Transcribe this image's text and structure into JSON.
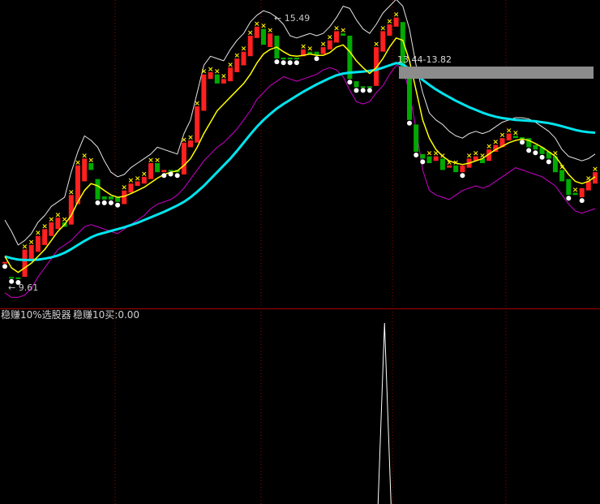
{
  "annotations": {
    "high_label": "15.49",
    "low_label": "9.61",
    "range_label": "13.44-13.82"
  },
  "indicator": {
    "name": "稳赚10%选股器",
    "value_label": "稳赚10买:0.00"
  },
  "colors": {
    "background": "#000000",
    "up_candle": "#ff2020",
    "down_candle": "#00aa00",
    "fast_ma": "#ffff00",
    "slow_ma": "#00e5ee",
    "upper_band": "#e6e6e6",
    "lower_band": "#cc00cc",
    "marker_x": "#ffee00",
    "marker_dot": "#ffffff",
    "pane_divider": "#aa0000",
    "v_grid": "#a00000",
    "range_box": "#8c8c8c"
  },
  "chart_data": {
    "type": "candlestick",
    "price_range": [
      9.2,
      15.8
    ],
    "candles": [
      {
        "o": 10.05,
        "c": 10.08,
        "m": "dot"
      },
      {
        "o": 9.75,
        "c": 9.72,
        "m": "dot"
      },
      {
        "o": 9.74,
        "c": 9.7,
        "m": "dot"
      },
      {
        "o": 9.75,
        "c": 10.35,
        "m": "x"
      },
      {
        "o": 10.1,
        "c": 10.45,
        "m": "x"
      },
      {
        "o": 10.3,
        "c": 10.65,
        "m": "x"
      },
      {
        "o": 10.45,
        "c": 10.8,
        "m": "x"
      },
      {
        "o": 10.65,
        "c": 10.95,
        "m": "x"
      },
      {
        "o": 10.8,
        "c": 11.05,
        "m": "x"
      },
      {
        "o": 10.95,
        "c": 10.85,
        "m": "x"
      },
      {
        "o": 10.9,
        "c": 11.55,
        "m": "x"
      },
      {
        "o": 11.35,
        "c": 12.2,
        "m": "x"
      },
      {
        "o": 11.85,
        "c": 12.35,
        "m": "x"
      },
      {
        "o": 12.25,
        "c": 12.1,
        "m": "x"
      },
      {
        "o": 11.9,
        "c": 11.45,
        "m": "dot"
      },
      {
        "o": 11.52,
        "c": 11.45,
        "m": "dot"
      },
      {
        "o": 11.52,
        "c": 11.45,
        "m": "dot"
      },
      {
        "o": 11.5,
        "c": 11.4,
        "m": "dot"
      },
      {
        "o": 11.35,
        "c": 11.65,
        "m": "x"
      },
      {
        "o": 11.6,
        "c": 11.8,
        "m": "x"
      },
      {
        "o": 11.75,
        "c": 11.85,
        "m": "x"
      },
      {
        "o": 11.8,
        "c": 11.95,
        "m": "x"
      },
      {
        "o": 11.9,
        "c": 12.25,
        "m": "x"
      },
      {
        "o": 12.25,
        "c": 12.05,
        "m": "x"
      },
      {
        "o": 12.05,
        "c": 12.1,
        "m": "dot"
      },
      {
        "o": 12.1,
        "c": 12.08,
        "m": "dot"
      },
      {
        "o": 12.1,
        "c": 12.05,
        "m": "dot"
      },
      {
        "o": 12.0,
        "c": 12.7,
        "m": "x"
      },
      {
        "o": 12.6,
        "c": 12.75,
        "m": "x"
      },
      {
        "o": 12.7,
        "c": 13.5,
        "m": "x"
      },
      {
        "o": 13.4,
        "c": 14.2,
        "m": "x"
      },
      {
        "o": 14.1,
        "c": 14.25,
        "m": "x"
      },
      {
        "o": 14.2,
        "c": 14.0,
        "m": "x"
      },
      {
        "o": 14.0,
        "c": 14.1,
        "m": "x"
      },
      {
        "o": 14.05,
        "c": 14.35,
        "m": "x"
      },
      {
        "o": 14.25,
        "c": 14.55,
        "m": "x"
      },
      {
        "o": 14.4,
        "c": 14.7,
        "m": "x"
      },
      {
        "o": 14.6,
        "c": 15.05,
        "m": "x"
      },
      {
        "o": 15.0,
        "c": 15.25,
        "m": "x"
      },
      {
        "o": 15.2,
        "c": 14.85,
        "m": "x"
      },
      {
        "o": 14.8,
        "c": 15.1,
        "m": "x"
      },
      {
        "o": 15.05,
        "c": 14.55,
        "m": "dot"
      },
      {
        "o": 14.57,
        "c": 14.53,
        "m": "dot"
      },
      {
        "o": 14.57,
        "c": 14.53,
        "m": "dot"
      },
      {
        "o": 14.57,
        "c": 14.53,
        "m": "dot"
      },
      {
        "o": 14.6,
        "c": 14.75,
        "m": "x"
      },
      {
        "o": 14.7,
        "c": 14.65,
        "m": "x"
      },
      {
        "o": 14.7,
        "c": 14.62,
        "m": "dot"
      },
      {
        "o": 14.65,
        "c": 14.8,
        "m": "x"
      },
      {
        "o": 14.75,
        "c": 14.95,
        "m": "x"
      },
      {
        "o": 14.9,
        "c": 15.15,
        "m": "x"
      },
      {
        "o": 15.1,
        "c": 15.05,
        "m": "x"
      },
      {
        "o": 15.05,
        "c": 14.1,
        "m": "dot"
      },
      {
        "o": 14.05,
        "c": 13.92,
        "m": "dot"
      },
      {
        "o": 13.94,
        "c": 13.92,
        "m": "dot"
      },
      {
        "o": 13.94,
        "c": 13.92,
        "m": "dot"
      },
      {
        "o": 13.95,
        "c": 14.8,
        "m": "x"
      },
      {
        "o": 14.7,
        "c": 15.15,
        "m": "x"
      },
      {
        "o": 15.05,
        "c": 15.3,
        "m": "x"
      },
      {
        "o": 15.25,
        "c": 15.45,
        "m": "x"
      },
      {
        "o": 15.35,
        "c": 14.3,
        "m": "dot"
      },
      {
        "o": 14.2,
        "c": 13.2,
        "m": "dot"
      },
      {
        "o": 13.1,
        "c": 12.5,
        "m": "dot"
      },
      {
        "o": 12.45,
        "c": 12.35,
        "m": "dot"
      },
      {
        "o": 12.4,
        "c": 12.25,
        "m": "x"
      },
      {
        "o": 12.3,
        "c": 12.4,
        "m": "x"
      },
      {
        "o": 12.35,
        "c": 12.1,
        "m": "x"
      },
      {
        "o": 12.15,
        "c": 12.2,
        "m": "x"
      },
      {
        "o": 12.2,
        "c": 12.05,
        "m": "x"
      },
      {
        "o": 12.05,
        "c": 12.2,
        "m": "dot"
      },
      {
        "o": 12.15,
        "c": 12.35,
        "m": "x"
      },
      {
        "o": 12.3,
        "c": 12.4,
        "m": "x"
      },
      {
        "o": 12.35,
        "c": 12.25,
        "m": "x"
      },
      {
        "o": 12.3,
        "c": 12.55,
        "m": "x"
      },
      {
        "o": 12.5,
        "c": 12.65,
        "m": "x"
      },
      {
        "o": 12.6,
        "c": 12.8,
        "m": "x"
      },
      {
        "o": 12.75,
        "c": 12.9,
        "m": "x"
      },
      {
        "o": 12.85,
        "c": 12.8,
        "m": "x"
      },
      {
        "o": 12.82,
        "c": 12.78,
        "m": "dot"
      },
      {
        "o": 12.8,
        "c": 12.6,
        "m": "dot"
      },
      {
        "o": 12.65,
        "c": 12.55,
        "m": "dot"
      },
      {
        "o": 12.6,
        "c": 12.45,
        "m": "dot"
      },
      {
        "o": 12.5,
        "c": 12.35,
        "m": "dot"
      },
      {
        "o": 12.4,
        "c": 12.05,
        "m": "x"
      },
      {
        "o": 12.1,
        "c": 11.85,
        "m": "x"
      },
      {
        "o": 11.9,
        "c": 11.55,
        "m": "dot"
      },
      {
        "o": 11.6,
        "c": 11.55,
        "m": "x"
      },
      {
        "o": 11.5,
        "c": 11.7,
        "m": "dot"
      },
      {
        "o": 11.65,
        "c": 11.85,
        "m": "x"
      },
      {
        "o": 11.8,
        "c": 12.05,
        "m": "x"
      }
    ],
    "slow_ma": [
      10.2,
      10.16,
      10.13,
      10.12,
      10.12,
      10.13,
      10.15,
      10.18,
      10.22,
      10.28,
      10.36,
      10.45,
      10.54,
      10.62,
      10.68,
      10.72,
      10.76,
      10.8,
      10.84,
      10.89,
      10.94,
      11.0,
      11.06,
      11.12,
      11.18,
      11.25,
      11.32,
      11.4,
      11.5,
      11.62,
      11.75,
      11.9,
      12.05,
      12.2,
      12.35,
      12.52,
      12.7,
      12.88,
      13.05,
      13.2,
      13.33,
      13.45,
      13.55,
      13.64,
      13.73,
      13.82,
      13.9,
      13.98,
      14.05,
      14.12,
      14.18,
      14.22,
      14.24,
      14.25,
      14.26,
      14.28,
      14.3,
      14.35,
      14.4,
      14.45,
      14.42,
      14.32,
      14.2,
      14.08,
      13.97,
      13.87,
      13.78,
      13.7,
      13.62,
      13.55,
      13.48,
      13.42,
      13.36,
      13.31,
      13.27,
      13.24,
      13.22,
      13.2,
      13.19,
      13.18,
      13.17,
      13.15,
      13.13,
      13.1,
      13.06,
      13.02,
      12.98,
      12.95,
      12.93,
      12.92
    ],
    "fast_ma": [
      10.2,
      9.95,
      9.85,
      9.95,
      10.05,
      10.2,
      10.35,
      10.55,
      10.75,
      10.9,
      11.1,
      11.4,
      11.65,
      11.8,
      11.75,
      11.65,
      11.55,
      11.5,
      11.52,
      11.58,
      11.65,
      11.72,
      11.82,
      11.92,
      12.0,
      12.05,
      12.08,
      12.2,
      12.35,
      12.6,
      12.9,
      13.15,
      13.4,
      13.55,
      13.7,
      13.85,
      14.0,
      14.2,
      14.45,
      14.65,
      14.75,
      14.8,
      14.7,
      14.62,
      14.6,
      14.62,
      14.65,
      14.62,
      14.62,
      14.68,
      14.8,
      14.85,
      14.7,
      14.5,
      14.35,
      14.22,
      14.35,
      14.55,
      14.8,
      15.0,
      14.95,
      14.5,
      13.85,
      13.2,
      12.8,
      12.55,
      12.4,
      12.3,
      12.25,
      12.22,
      12.25,
      12.3,
      12.35,
      12.45,
      12.55,
      12.62,
      12.7,
      12.75,
      12.78,
      12.75,
      12.68,
      12.6,
      12.5,
      12.4,
      12.2,
      12.0,
      11.85,
      11.8,
      11.85,
      11.95
    ],
    "upper_band": [
      11.0,
      10.75,
      10.45,
      10.55,
      10.7,
      10.95,
      11.1,
      11.3,
      11.4,
      11.5,
      12.05,
      12.5,
      12.85,
      12.75,
      12.6,
      12.3,
      12.05,
      11.95,
      12.0,
      12.15,
      12.25,
      12.35,
      12.45,
      12.6,
      12.55,
      12.5,
      12.45,
      12.9,
      13.2,
      13.8,
      14.4,
      14.6,
      14.55,
      14.5,
      14.75,
      14.95,
      15.1,
      15.35,
      15.5,
      15.6,
      15.55,
      15.45,
      15.3,
      15.05,
      15.0,
      15.05,
      15.1,
      15.05,
      15.1,
      15.25,
      15.45,
      15.7,
      15.65,
      15.4,
      15.2,
      15.1,
      15.3,
      15.55,
      15.7,
      15.85,
      15.7,
      15.2,
      14.4,
      13.8,
      13.35,
      13.2,
      13.1,
      12.95,
      12.85,
      12.8,
      12.9,
      12.95,
      12.9,
      12.95,
      13.05,
      13.15,
      13.2,
      13.25,
      13.25,
      13.22,
      13.15,
      13.05,
      12.95,
      12.8,
      12.55,
      12.4,
      12.35,
      12.3,
      12.35,
      12.45
    ],
    "lower_band": [
      9.4,
      9.3,
      9.3,
      9.35,
      9.5,
      9.75,
      9.95,
      10.15,
      10.35,
      10.45,
      10.55,
      10.7,
      10.85,
      10.9,
      10.85,
      10.8,
      10.75,
      10.7,
      10.8,
      10.9,
      11.0,
      11.1,
      11.25,
      11.35,
      11.4,
      11.45,
      11.55,
      11.7,
      11.9,
      12.1,
      12.3,
      12.45,
      12.6,
      12.7,
      12.85,
      13.0,
      13.2,
      13.4,
      13.65,
      13.8,
      13.95,
      14.05,
      14.15,
      14.1,
      14.05,
      14.1,
      14.15,
      14.2,
      14.3,
      14.35,
      14.3,
      14.15,
      13.85,
      13.6,
      13.55,
      13.6,
      13.8,
      13.95,
      14.2,
      14.4,
      14.35,
      13.8,
      13.0,
      12.1,
      11.65,
      11.55,
      11.5,
      11.45,
      11.55,
      11.65,
      11.7,
      11.75,
      11.7,
      11.75,
      11.85,
      11.95,
      12.05,
      12.15,
      12.1,
      12.05,
      12.0,
      11.95,
      11.85,
      11.75,
      11.55,
      11.35,
      11.2,
      11.15,
      11.2,
      11.25
    ],
    "indicator_spike_index": 57
  }
}
